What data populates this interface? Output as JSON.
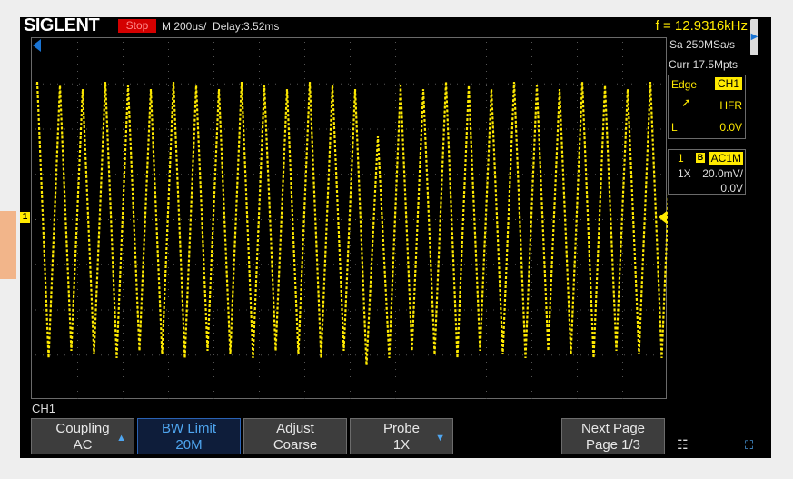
{
  "header": {
    "logo": "SIGLENT",
    "status": "Stop",
    "timebase": "M 200us/",
    "delay": "Delay:3.52ms",
    "frequency": "f = 12.9316kHz"
  },
  "acquisition": {
    "sample_rate": "Sa 250MSa/s",
    "memory_depth": "Curr 17.5Mpts"
  },
  "trigger": {
    "type": "Edge",
    "source": "CH1",
    "coupling": "HFR",
    "mode": "L",
    "level": "0.0V"
  },
  "channel": {
    "number": "1",
    "bw_icon": "B",
    "coupling": "AC1M",
    "probe": "1X",
    "scale": "20.0mV/",
    "offset": "0.0V",
    "marker": "1"
  },
  "menu": {
    "title": "CH1",
    "softkeys": [
      {
        "label": "Coupling",
        "value": "AC"
      },
      {
        "label": "BW Limit",
        "value": "20M"
      },
      {
        "label": "Adjust",
        "value": "Coarse"
      },
      {
        "label": "Probe",
        "value": "1X"
      },
      {
        "label": "Next Page",
        "value": "Page 1/3"
      }
    ]
  },
  "icons": [
    "trigger-position-icon",
    "edge-rising-icon",
    "network-icon",
    "expand-icon",
    "channel-marker-icon",
    "trigger-level-icon"
  ],
  "colors": {
    "trace": "#ffea00",
    "accent": "#1a74d4",
    "stop": "#d40000",
    "screen": "#000000"
  }
}
